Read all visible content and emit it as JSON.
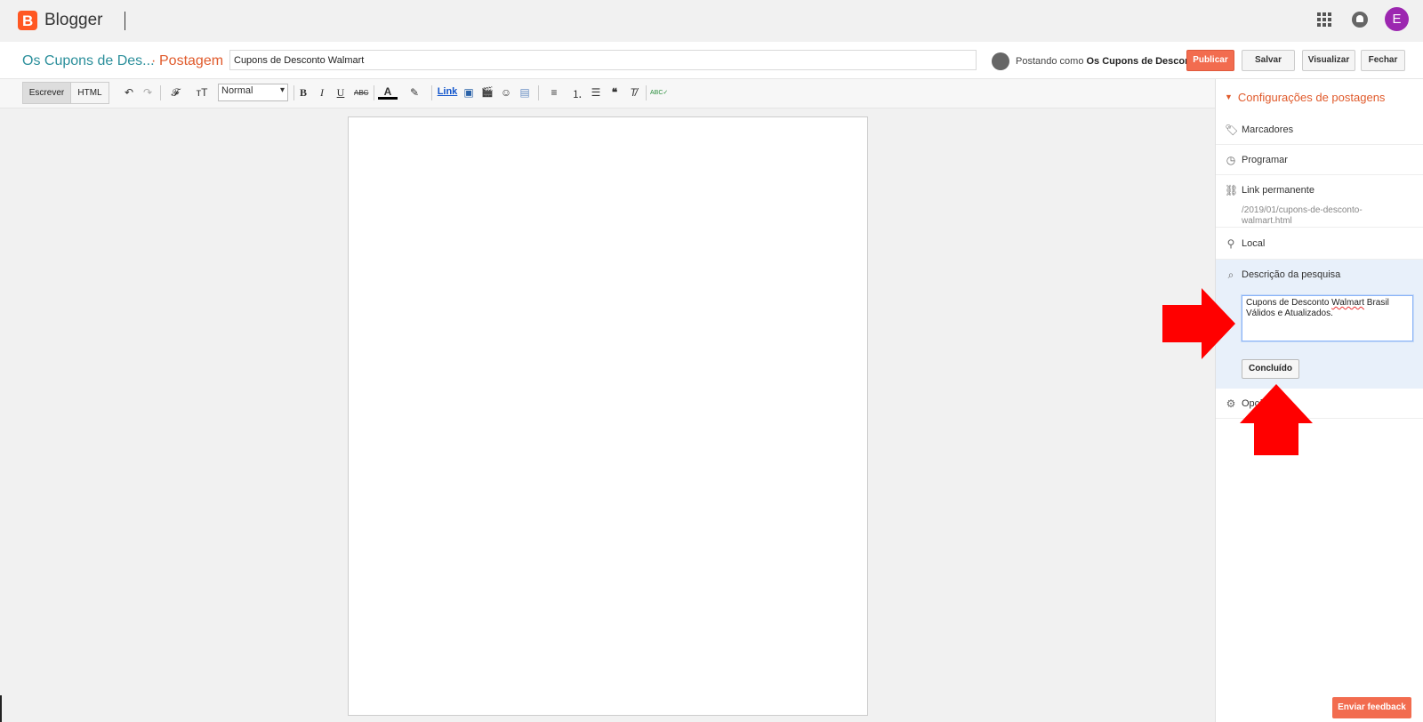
{
  "app": {
    "brand": "Blogger",
    "logo_letter": "B",
    "avatar_letter": "E"
  },
  "post_header": {
    "blog_name": "Os Cupons de Des...",
    "separator": "·",
    "section": "Postagem",
    "title_value": "Cupons de Desconto Walmart",
    "posting_as_prefix": "Postando como",
    "posting_as_name": "Os Cupons de Desconto",
    "publish_label": "Publicar",
    "save_label": "Salvar",
    "preview_label": "Visualizar",
    "close_label": "Fechar"
  },
  "toolbar": {
    "compose_label": "Escrever",
    "html_label": "HTML",
    "format_value": "Normal",
    "link_label": "Link",
    "undo": "↶",
    "redo": "↷",
    "font": "𝓕",
    "size": "тT",
    "bold": "B",
    "italic": "I",
    "underline": "U",
    "strike": "ABC",
    "text_color": "A",
    "highlight": "✎",
    "image": "▣",
    "video": "🎬",
    "emoji": "☺",
    "jump": "▤",
    "align": "≡",
    "numbered": "⒈",
    "bulleted": "☰",
    "quote": "❝",
    "clear": "T̸",
    "spell": "ABC✓"
  },
  "sidebar": {
    "title": "Configurações de postagens",
    "labels_label": "Marcadores",
    "schedule_label": "Programar",
    "permalink_label": "Link permanente",
    "permalink_value": "/2019/01/cupons-de-desconto-walmart.html",
    "location_label": "Local",
    "search_desc_label": "Descrição da pesquisa",
    "search_desc_value_a": "Cupons de Desconto ",
    "search_desc_value_b": "Walmart",
    "search_desc_value_c": " Brasil Válidos e Atualizados.",
    "done_label": "Concluído",
    "options_label": "Opções"
  },
  "feedback_label": "Enviar feedback",
  "colors": {
    "accent": "#f26c4f",
    "blog_name": "#2b8f9b",
    "arrow": "#ff0000",
    "avatar": "#9c27b0"
  }
}
